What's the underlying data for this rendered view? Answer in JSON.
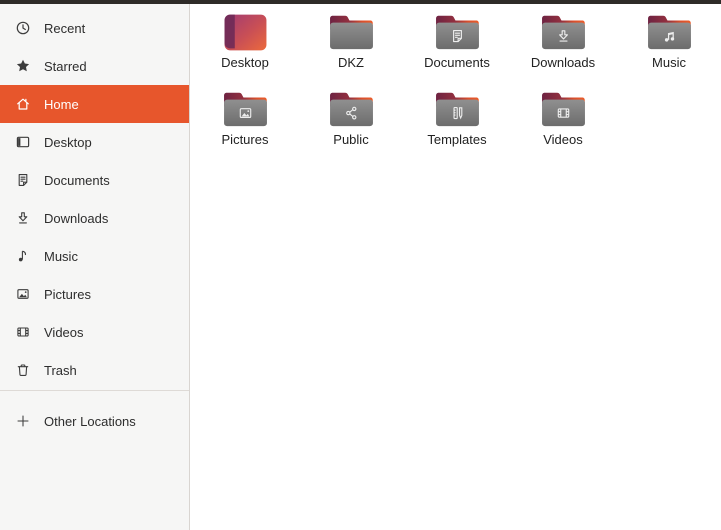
{
  "colors": {
    "accent": "#e7562c",
    "topbar": "#2e2b28",
    "sidebar_bg": "#f6f6f5",
    "divider": "#d9d5d1",
    "folder_flap_start": "#6e2342",
    "folder_flap_end": "#ec5d2a",
    "folder_body": "#7d7d7d"
  },
  "sidebar": {
    "items": [
      {
        "label": "Recent",
        "icon": "recent-icon",
        "selected": false
      },
      {
        "label": "Starred",
        "icon": "star-icon",
        "selected": false
      },
      {
        "label": "Home",
        "icon": "home-icon",
        "selected": true
      },
      {
        "label": "Desktop",
        "icon": "desktop-panel-icon",
        "selected": false
      },
      {
        "label": "Documents",
        "icon": "documents-icon",
        "selected": false
      },
      {
        "label": "Downloads",
        "icon": "downloads-icon",
        "selected": false
      },
      {
        "label": "Music",
        "icon": "music-icon",
        "selected": false
      },
      {
        "label": "Pictures",
        "icon": "pictures-icon",
        "selected": false
      },
      {
        "label": "Videos",
        "icon": "videos-icon",
        "selected": false
      },
      {
        "label": "Trash",
        "icon": "trash-icon",
        "selected": false
      }
    ],
    "footer_item": {
      "label": "Other Locations",
      "icon": "plus-icon"
    }
  },
  "files": [
    {
      "name": "Desktop",
      "kind": "desktop",
      "emblem": null
    },
    {
      "name": "DKZ",
      "kind": "folder",
      "emblem": null
    },
    {
      "name": "Documents",
      "kind": "folder",
      "emblem": "documents"
    },
    {
      "name": "Downloads",
      "kind": "folder",
      "emblem": "downloads"
    },
    {
      "name": "Music",
      "kind": "folder",
      "emblem": "music"
    },
    {
      "name": "Pictures",
      "kind": "folder",
      "emblem": "pictures"
    },
    {
      "name": "Public",
      "kind": "folder",
      "emblem": "share"
    },
    {
      "name": "Templates",
      "kind": "folder",
      "emblem": "templates"
    },
    {
      "name": "Videos",
      "kind": "folder",
      "emblem": "videos"
    }
  ]
}
